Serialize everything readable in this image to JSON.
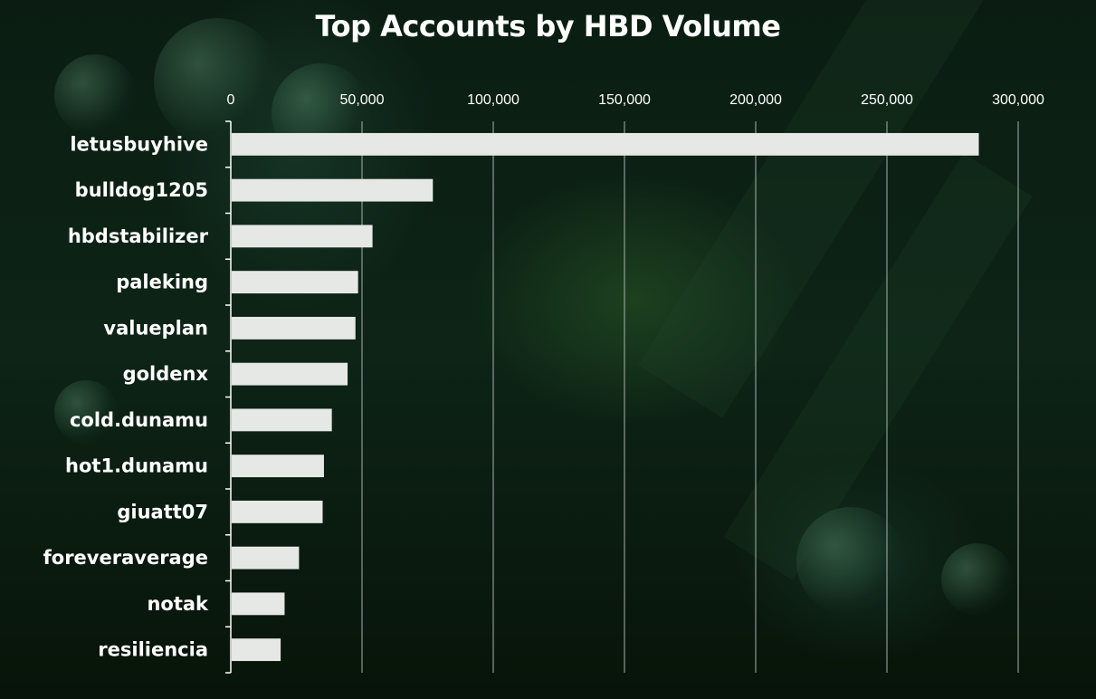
{
  "chart_data": {
    "type": "bar",
    "orientation": "horizontal",
    "title": "Top Accounts by HBD Volume",
    "categories": [
      "letusbuyhive",
      "bulldog1205",
      "hbdstabilizer",
      "paleking",
      "valueplan",
      "goldenx",
      "cold.dunamu",
      "hot1.dunamu",
      "giuatt07",
      "foreveraverage",
      "notak",
      "resiliencia"
    ],
    "values": [
      285000,
      77000,
      54000,
      48500,
      47500,
      44500,
      38500,
      35500,
      35000,
      26000,
      20500,
      19000
    ],
    "xlim": [
      0,
      300000
    ],
    "ticks": [
      0,
      50000,
      100000,
      150000,
      200000,
      250000,
      300000
    ],
    "tick_labels": [
      "0",
      "50,000",
      "100,000",
      "150,000",
      "200,000",
      "250,000",
      "300,000"
    ],
    "xaxis_position": "top",
    "grid": true,
    "legend": "none",
    "colors": {
      "bar": "#e6e8e6",
      "grid": "#b8c2bc",
      "text": "#ffffff",
      "axis": "#ffffff"
    }
  }
}
